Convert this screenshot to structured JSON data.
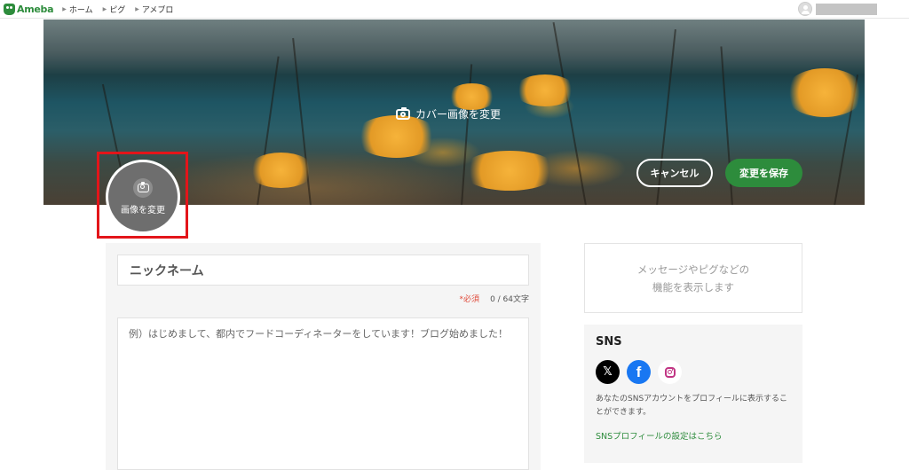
{
  "header": {
    "logo_text": "Ameba",
    "nav": [
      {
        "label": "ホーム"
      },
      {
        "label": "ピグ"
      },
      {
        "label": "アメブロ"
      }
    ]
  },
  "cover": {
    "change_label": "カバー画像を変更",
    "cancel_label": "キャンセル",
    "save_label": "変更を保存"
  },
  "avatar": {
    "change_label": "画像を変更"
  },
  "form": {
    "nickname_placeholder": "ニックネーム",
    "required_label": "*必須",
    "char_count": "0 / 64文字",
    "bio_placeholder": "例）はじめまして、都内でフードコーディネーターをしています！ブログ始めました！"
  },
  "side": {
    "message_line1": "メッセージやピグなどの",
    "message_line2": "機能を表示します",
    "sns_title": "SNS",
    "sns_icons": [
      "x-icon",
      "facebook-icon",
      "instagram-icon"
    ],
    "sns_desc": "あなたのSNSアカウントをプロフィールに表示することができます。",
    "sns_link": "SNSプロフィールの設定はこちら"
  },
  "colors": {
    "accent_green": "#2d8c3c",
    "highlight_red": "#e3151a",
    "required_red": "#e04a3a"
  }
}
